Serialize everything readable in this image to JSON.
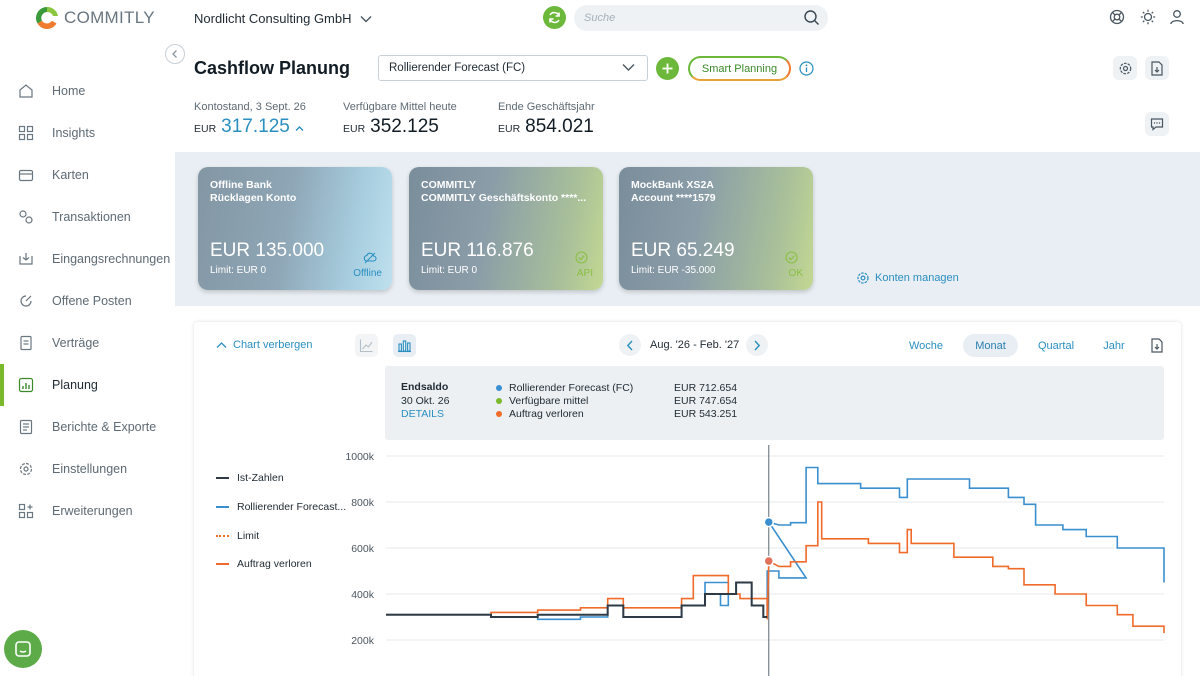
{
  "app": {
    "logo_text": "COMMITLY",
    "company": "Nordlicht Consulting GmbH"
  },
  "search": {
    "placeholder": "Suche"
  },
  "sidebar": {
    "items": [
      {
        "label": "Home",
        "icon": "home-icon"
      },
      {
        "label": "Insights",
        "icon": "insights-icon"
      },
      {
        "label": "Karten",
        "icon": "cards-icon"
      },
      {
        "label": "Transaktionen",
        "icon": "transactions-icon"
      },
      {
        "label": "Eingangsrechnungen",
        "icon": "invoice-icon"
      },
      {
        "label": "Offene Posten",
        "icon": "open-items-icon"
      },
      {
        "label": "Verträge",
        "icon": "contracts-icon"
      },
      {
        "label": "Planung",
        "icon": "planning-icon",
        "active": true
      },
      {
        "label": "Berichte & Exporte",
        "icon": "reports-icon"
      },
      {
        "label": "Einstellungen",
        "icon": "settings-icon"
      },
      {
        "label": "Erweiterungen",
        "icon": "extensions-icon"
      }
    ]
  },
  "header": {
    "title": "Cashflow Planung",
    "plan_select": "Rollierender Forecast (FC)",
    "smart_planning": "Smart Planning"
  },
  "stats": [
    {
      "label": "Kontostand, 3 Sept. 26",
      "currency": "EUR",
      "value": "317.125"
    },
    {
      "label": "Verfügbare Mittel heute",
      "currency": "EUR",
      "value": "352.125"
    },
    {
      "label": "Ende Geschäftsjahr",
      "currency": "EUR",
      "value": "854.021"
    }
  ],
  "accounts": [
    {
      "bank": "Offline Bank",
      "name": "Rücklagen Konto",
      "amount": "EUR 135.000",
      "limit": "Limit: EUR 0",
      "status": "Offline"
    },
    {
      "bank": "COMMITLY",
      "name": "COMMITLY Geschäftskonto ****...",
      "amount": "EUR 116.876",
      "limit": "Limit: EUR 0",
      "status": "API"
    },
    {
      "bank": "MockBank XS2A",
      "name": "Account ****1579",
      "amount": "EUR 65.249",
      "limit": "Limit: EUR -35.000",
      "status": "OK"
    }
  ],
  "manage_accounts": "Konten managen",
  "chart_controls": {
    "hide_chart": "Chart verbergen",
    "period": "Aug. '26 - Feb. '27",
    "granularity": [
      "Woche",
      "Monat",
      "Quartal",
      "Jahr"
    ],
    "selected_granularity": "Monat"
  },
  "tooltip": {
    "title": "Endsaldo",
    "date": "30 Okt. 26",
    "link": "DETAILS",
    "rows": [
      {
        "label": "Rollierender Forecast (FC)",
        "value": "EUR 712.654",
        "color": "#3a8fd0"
      },
      {
        "label": "Verfügbare mittel",
        "value": "EUR 747.654",
        "color": "#7ab82c"
      },
      {
        "label": "Auftrag verloren",
        "value": "EUR 543.251",
        "color": "#f06a2a"
      }
    ]
  },
  "colors": {
    "accent_green": "#6cb83a",
    "link_blue": "#2a8fc0",
    "forecast_blue": "#3a8fd0",
    "lost_orange": "#f06a2a",
    "actuals_dark": "#2e3b46"
  },
  "chart_data": {
    "type": "line",
    "y_ticks": [
      "1000k",
      "800k",
      "600k",
      "400k",
      "200k"
    ],
    "ylim": [
      200000,
      1000000
    ],
    "grid": true,
    "legend_placement": "left",
    "series": [
      {
        "name": "Ist-Zahlen",
        "color": "#2e3b46",
        "style": "solid",
        "points": [
          [
            0,
            310000
          ],
          [
            0.135,
            310000
          ],
          [
            0.135,
            300000
          ],
          [
            0.195,
            300000
          ],
          [
            0.195,
            310000
          ],
          [
            0.285,
            310000
          ],
          [
            0.285,
            350000
          ],
          [
            0.305,
            350000
          ],
          [
            0.305,
            300000
          ],
          [
            0.38,
            300000
          ],
          [
            0.38,
            350000
          ],
          [
            0.41,
            350000
          ],
          [
            0.41,
            400000
          ],
          [
            0.45,
            400000
          ],
          [
            0.45,
            450000
          ],
          [
            0.47,
            450000
          ],
          [
            0.47,
            350000
          ],
          [
            0.485,
            350000
          ],
          [
            0.485,
            300000
          ],
          [
            0.49,
            300000
          ]
        ]
      },
      {
        "name": "Rollierender Forecast...",
        "color": "#3a8fd0",
        "style": "solid",
        "points": [
          [
            0,
            310000
          ],
          [
            0.135,
            310000
          ],
          [
            0.135,
            300000
          ],
          [
            0.195,
            300000
          ],
          [
            0.195,
            290000
          ],
          [
            0.25,
            290000
          ],
          [
            0.25,
            300000
          ],
          [
            0.285,
            300000
          ],
          [
            0.285,
            350000
          ],
          [
            0.305,
            350000
          ],
          [
            0.305,
            300000
          ],
          [
            0.38,
            300000
          ],
          [
            0.38,
            350000
          ],
          [
            0.41,
            350000
          ],
          [
            0.41,
            450000
          ],
          [
            0.44,
            450000
          ],
          [
            0.44,
            350000
          ],
          [
            0.43,
            350000
          ],
          [
            0.43,
            400000
          ],
          [
            0.45,
            400000
          ],
          [
            0.45,
            450000
          ],
          [
            0.47,
            450000
          ],
          [
            0.47,
            350000
          ],
          [
            0.485,
            350000
          ],
          [
            0.485,
            300000
          ],
          [
            0.49,
            300000
          ],
          [
            0.49,
            500000
          ],
          [
            0.505,
            500000
          ],
          [
            0.505,
            470000
          ],
          [
            0.54,
            470000
          ],
          [
            0.54,
            470000
          ],
          [
            0.492,
            712654
          ],
          [
            0.505,
            700000
          ],
          [
            0.52,
            700000
          ],
          [
            0.52,
            710000
          ],
          [
            0.54,
            710000
          ],
          [
            0.54,
            950000
          ],
          [
            0.555,
            950000
          ],
          [
            0.555,
            880000
          ],
          [
            0.61,
            880000
          ],
          [
            0.61,
            860000
          ],
          [
            0.66,
            860000
          ],
          [
            0.66,
            820000
          ],
          [
            0.67,
            820000
          ],
          [
            0.67,
            900000
          ],
          [
            0.75,
            900000
          ],
          [
            0.75,
            860000
          ],
          [
            0.8,
            860000
          ],
          [
            0.8,
            820000
          ],
          [
            0.82,
            820000
          ],
          [
            0.82,
            790000
          ],
          [
            0.835,
            790000
          ],
          [
            0.835,
            700000
          ],
          [
            0.87,
            700000
          ],
          [
            0.87,
            680000
          ],
          [
            0.9,
            680000
          ],
          [
            0.9,
            650000
          ],
          [
            0.94,
            650000
          ],
          [
            0.94,
            600000
          ],
          [
            1.0,
            600000
          ],
          [
            1.0,
            450000
          ]
        ]
      },
      {
        "name": "Limit",
        "color": "#f06a2a",
        "style": "dotted",
        "points": []
      },
      {
        "name": "Auftrag verloren",
        "color": "#f06a2a",
        "style": "solid",
        "points": [
          [
            0,
            310000
          ],
          [
            0.135,
            310000
          ],
          [
            0.135,
            320000
          ],
          [
            0.195,
            320000
          ],
          [
            0.195,
            330000
          ],
          [
            0.25,
            330000
          ],
          [
            0.25,
            340000
          ],
          [
            0.285,
            340000
          ],
          [
            0.285,
            380000
          ],
          [
            0.305,
            380000
          ],
          [
            0.305,
            340000
          ],
          [
            0.38,
            340000
          ],
          [
            0.38,
            380000
          ],
          [
            0.395,
            380000
          ],
          [
            0.395,
            480000
          ],
          [
            0.44,
            480000
          ],
          [
            0.44,
            400000
          ],
          [
            0.455,
            400000
          ],
          [
            0.455,
            380000
          ],
          [
            0.49,
            380000
          ],
          [
            0.49,
            290000
          ],
          [
            0.492,
            543251
          ],
          [
            0.505,
            520000
          ],
          [
            0.52,
            520000
          ],
          [
            0.52,
            540000
          ],
          [
            0.54,
            540000
          ],
          [
            0.54,
            610000
          ],
          [
            0.555,
            610000
          ],
          [
            0.555,
            800000
          ],
          [
            0.56,
            800000
          ],
          [
            0.56,
            640000
          ],
          [
            0.62,
            640000
          ],
          [
            0.62,
            620000
          ],
          [
            0.66,
            620000
          ],
          [
            0.66,
            580000
          ],
          [
            0.67,
            580000
          ],
          [
            0.67,
            680000
          ],
          [
            0.675,
            680000
          ],
          [
            0.675,
            620000
          ],
          [
            0.73,
            620000
          ],
          [
            0.73,
            560000
          ],
          [
            0.78,
            560000
          ],
          [
            0.78,
            520000
          ],
          [
            0.8,
            520000
          ],
          [
            0.8,
            510000
          ],
          [
            0.82,
            510000
          ],
          [
            0.82,
            440000
          ],
          [
            0.86,
            440000
          ],
          [
            0.86,
            400000
          ],
          [
            0.9,
            400000
          ],
          [
            0.9,
            350000
          ],
          [
            0.94,
            350000
          ],
          [
            0.94,
            310000
          ],
          [
            0.96,
            310000
          ],
          [
            0.96,
            260000
          ],
          [
            1.0,
            260000
          ],
          [
            1.0,
            230000
          ]
        ]
      }
    ],
    "cursor_x": 0.492
  }
}
